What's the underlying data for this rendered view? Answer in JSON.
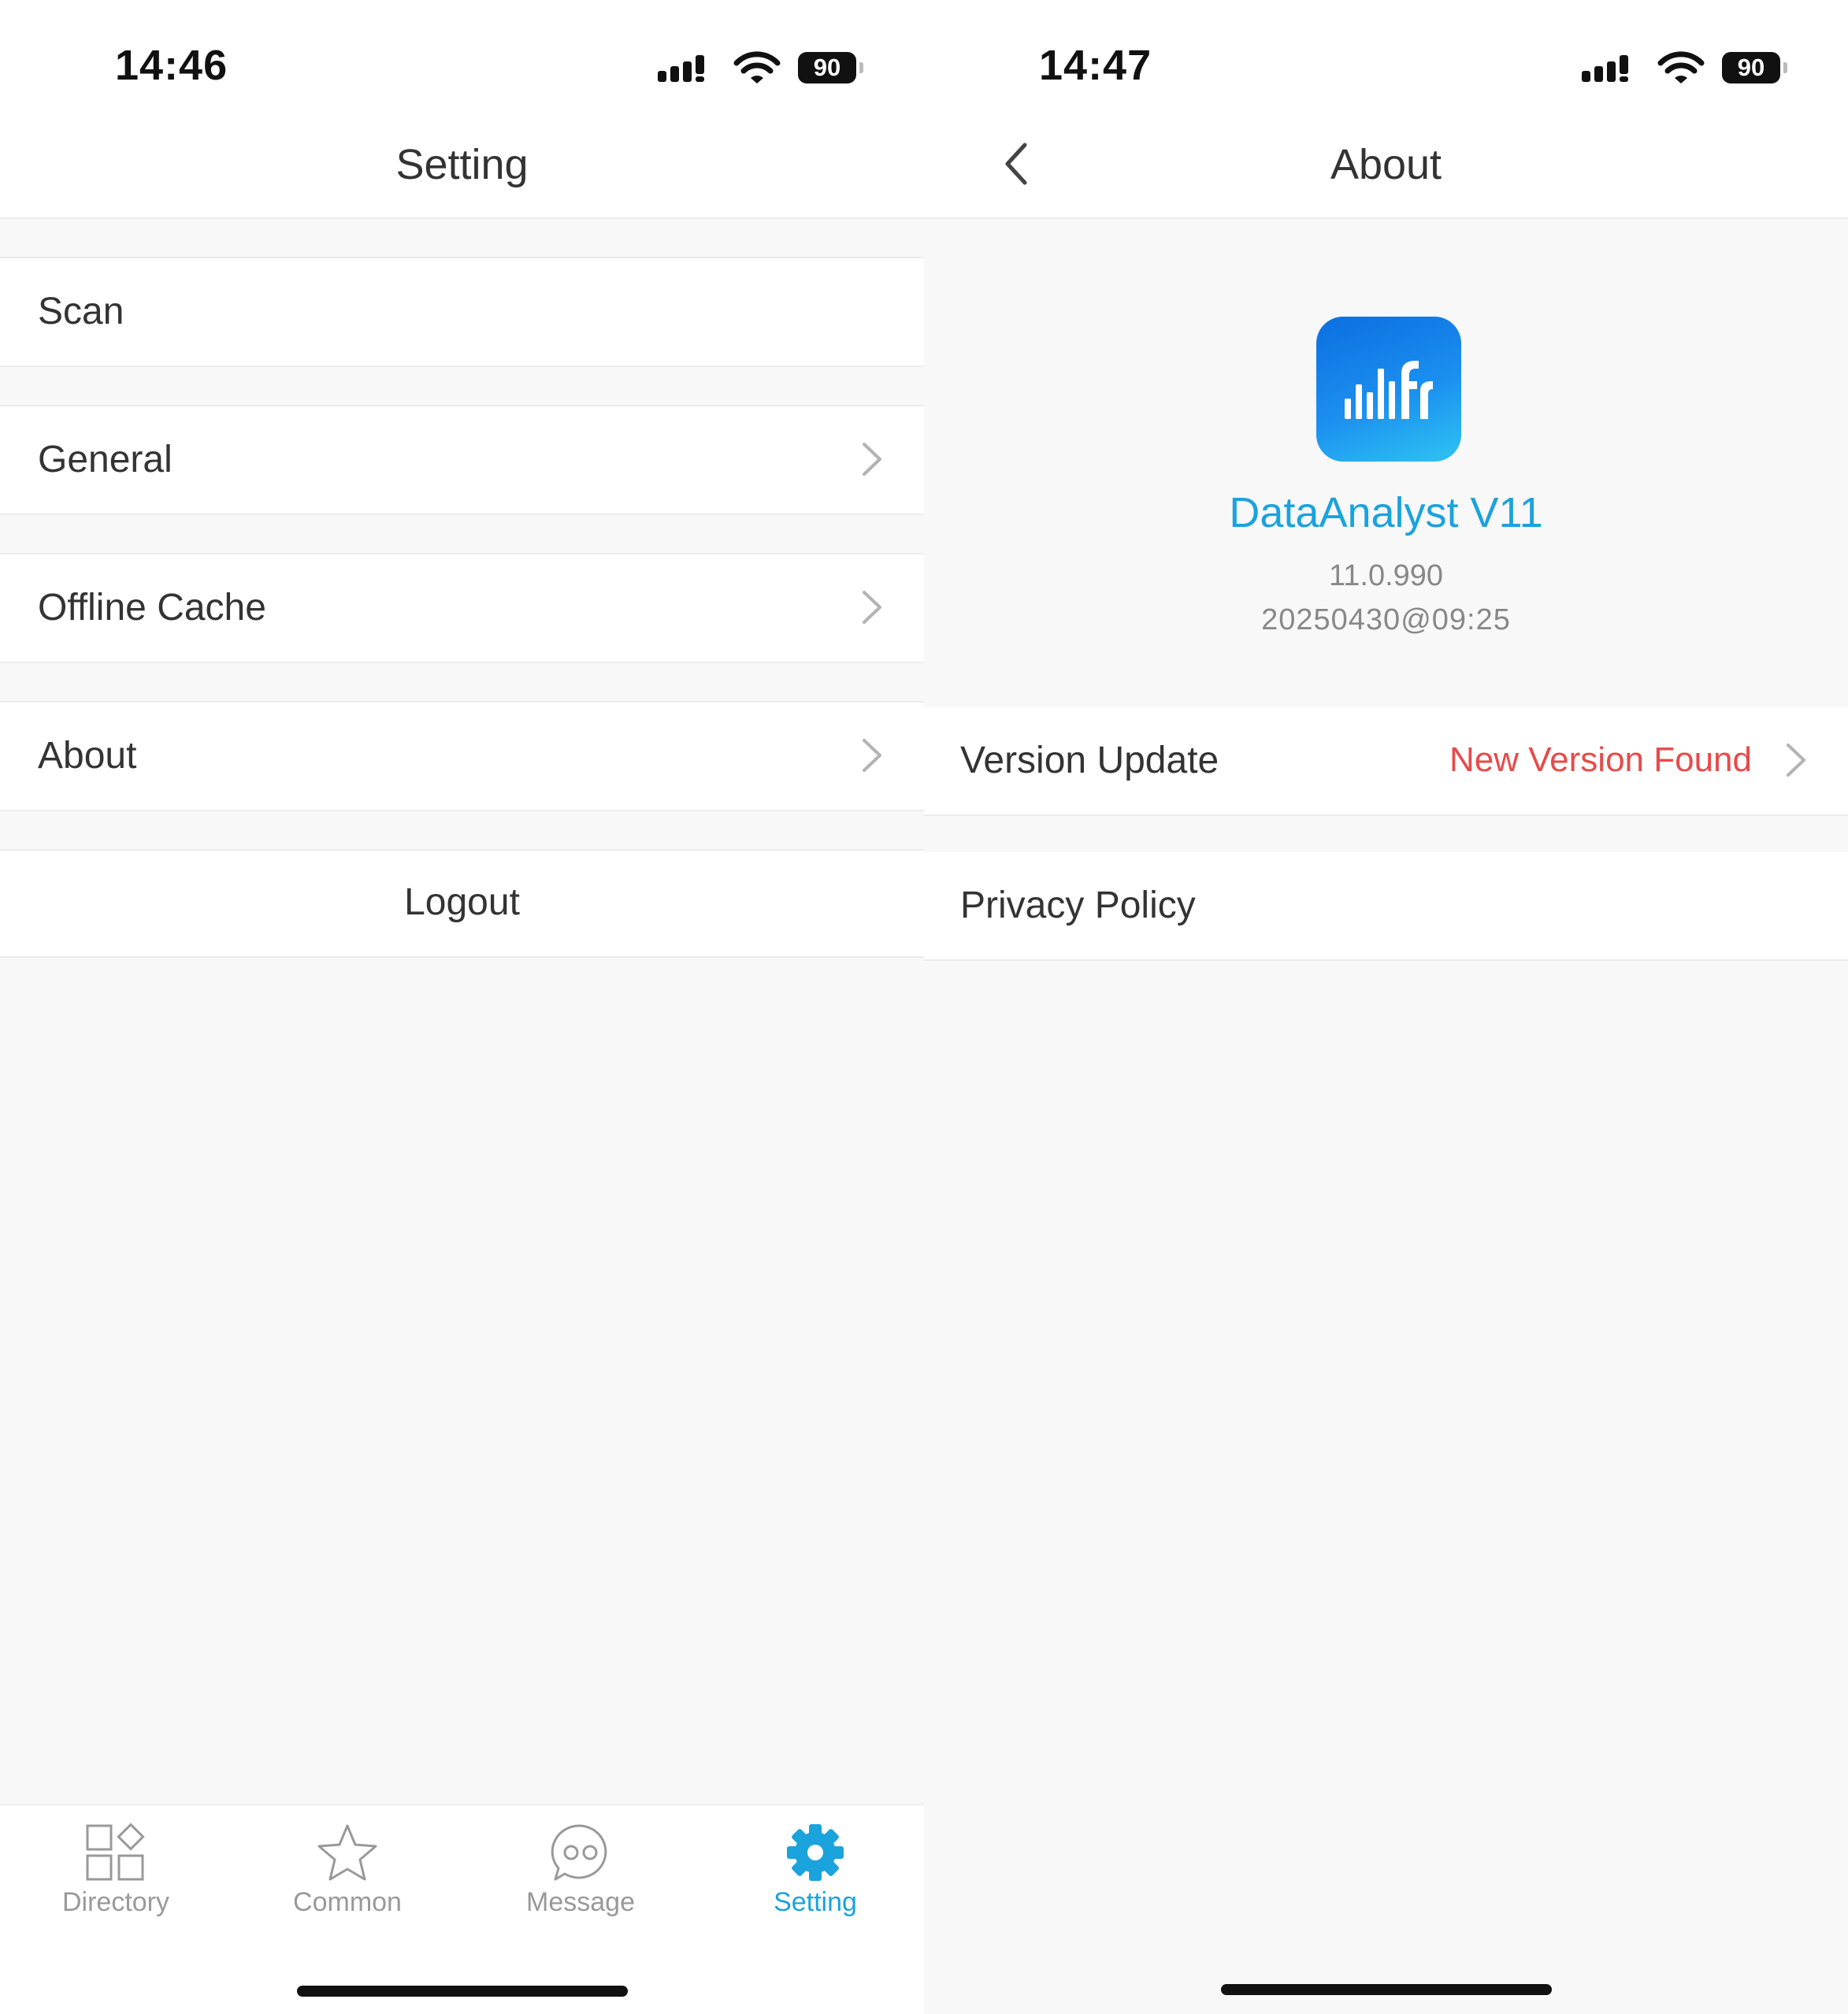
{
  "left_screen": {
    "status_bar": {
      "time": "14:46",
      "battery": "90"
    },
    "nav_title": "Setting",
    "rows": [
      {
        "label": "Scan"
      },
      {
        "label": "General"
      },
      {
        "label": "Offline Cache"
      },
      {
        "label": "About"
      }
    ],
    "logout_label": "Logout",
    "tabs": [
      {
        "label": "Directory",
        "icon": "directory-icon",
        "active": false
      },
      {
        "label": "Common",
        "icon": "star-icon",
        "active": false
      },
      {
        "label": "Message",
        "icon": "message-icon",
        "active": false
      },
      {
        "label": "Setting",
        "icon": "gear-icon",
        "active": true
      }
    ]
  },
  "right_screen": {
    "status_bar": {
      "time": "14:47",
      "battery": "90"
    },
    "nav_title": "About",
    "app": {
      "name": "DataAnalyst V11",
      "version": "11.0.990",
      "build": "20250430@09:25"
    },
    "rows": {
      "version_update": {
        "label": "Version Update",
        "status": "New Version Found"
      },
      "privacy_policy": {
        "label": "Privacy Policy"
      }
    }
  },
  "colors": {
    "accent": "#1aa3dd",
    "alert": "#e84a4a"
  }
}
